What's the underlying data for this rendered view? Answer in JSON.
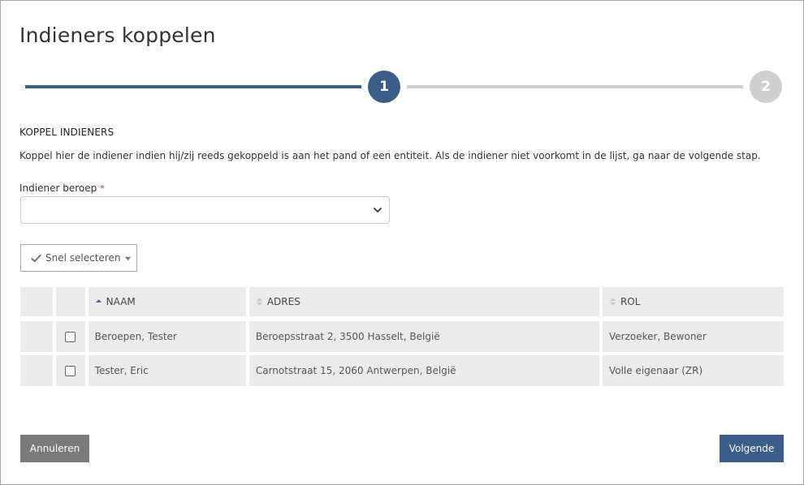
{
  "dialog": {
    "title": "Indieners koppelen"
  },
  "stepper": {
    "steps": [
      {
        "number": "1",
        "state": "active"
      },
      {
        "number": "2",
        "state": "inactive"
      }
    ],
    "active_color": "#3a5d8a",
    "inactive_color": "#cfcfcf"
  },
  "section": {
    "title": "KOPPEL INDIENERS",
    "intro": "Koppel hier de indiener indien hij/zij reeds gekoppeld is aan het pand of een entiteit. Als de indiener niet voorkomt in de lijst, ga naar de volgende stap."
  },
  "field": {
    "label": "Indiener beroep",
    "required_marker": "*",
    "value": ""
  },
  "quick_select": {
    "label": "Snel selecteren",
    "icon": "check-icon"
  },
  "table": {
    "columns": [
      {
        "label": "NAAM",
        "sort": "ascending"
      },
      {
        "label": "ADRES",
        "sort": "none"
      },
      {
        "label": "ROL",
        "sort": "none"
      }
    ],
    "rows": [
      {
        "checked": false,
        "naam": "Beroepen, Tester",
        "adres": "Beroepsstraat 2, 3500 Hasselt, België",
        "rol": "Verzoeker, Bewoner"
      },
      {
        "checked": false,
        "naam": "Tester, Eric",
        "adres": "Carnotstraat 15, 2060 Antwerpen, België",
        "rol": "Volle eigenaar (ZR)"
      }
    ]
  },
  "footer": {
    "cancel_label": "Annuleren",
    "next_label": "Volgende"
  }
}
